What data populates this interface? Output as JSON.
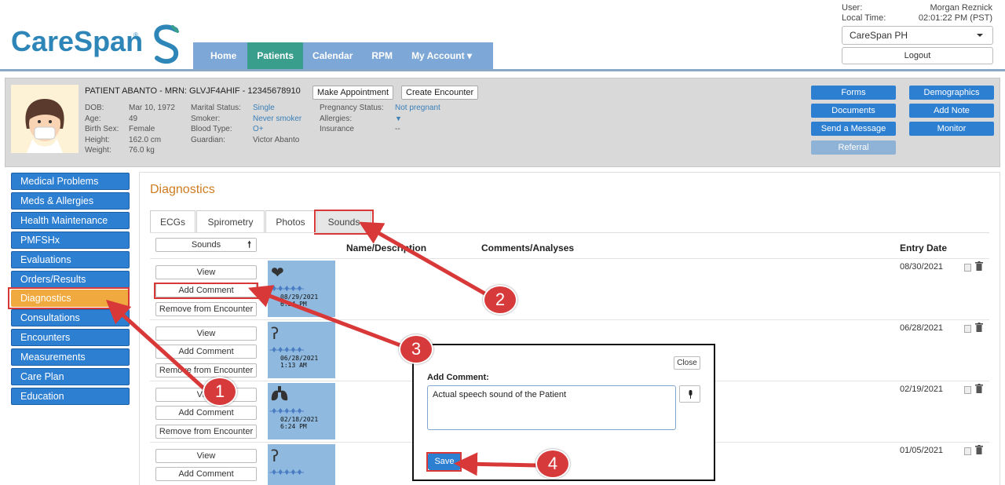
{
  "header": {
    "logo_text": "CareSpan",
    "logo_tm": "®",
    "nav": [
      "Home",
      "Patients",
      "Calendar",
      "RPM",
      "My Account ▾"
    ],
    "active_nav": "Patients",
    "user_label": "User:",
    "user_name": "Morgan Reznick",
    "time_label": "Local Time:",
    "local_time": "02:01:22 PM (PST)",
    "practice": "CareSpan PH",
    "logout": "Logout"
  },
  "patient": {
    "title": "PATIENT ABANTO - MRN: GLVJF4AHIF - 12345678910",
    "make_appointment": "Make Appointment",
    "create_encounter": "Create Encounter",
    "col1_labels": [
      "DOB:",
      "Age:",
      "Birth Sex:",
      "Height:",
      "Weight:"
    ],
    "col1_values": [
      "Mar 10, 1972",
      "49",
      "Female",
      "162.0 cm",
      "76.0 kg"
    ],
    "col2_labels": [
      "Marital Status:",
      "Smoker:",
      "Blood Type:",
      "Guardian:"
    ],
    "col2_values": [
      "Single",
      "Never smoker",
      "O+",
      "Victor Abanto"
    ],
    "col3_labels": [
      "Pregnancy Status:",
      "Allergies:",
      "Insurance"
    ],
    "col3_values": [
      "Not pregnant",
      "▼",
      "--"
    ],
    "actions_left": [
      "Forms",
      "Documents",
      "Send a Message",
      "Referral"
    ],
    "actions_right": [
      "Demographics",
      "Add Note",
      "Monitor"
    ]
  },
  "sidebar": {
    "items": [
      "Medical Problems",
      "Meds & Allergies",
      "Health Maintenance",
      "PMFSHx",
      "Evaluations",
      "Orders/Results",
      "Diagnostics",
      "Consultations",
      "Encounters",
      "Measurements",
      "Care Plan",
      "Education"
    ],
    "active": "Diagnostics"
  },
  "main": {
    "title": "Diagnostics",
    "tabs": [
      "ECGs",
      "Spirometry",
      "Photos",
      "Sounds"
    ],
    "active_tab": "Sounds",
    "sort_label": "Sounds",
    "columns": [
      "Name/Description",
      "Comments/Analyses",
      "Entry Date"
    ],
    "rows": [
      {
        "view": "View",
        "add_comment": "Add Comment",
        "remove": "Remove from Encounter",
        "icon": "heart-icon",
        "ts_date": "08/29/2021",
        "ts_time": "6:34 PM",
        "entry_date": "08/30/2021"
      },
      {
        "view": "View",
        "add_comment": "Add Comment",
        "remove": "Remove from Encounter",
        "icon": "ear-icon",
        "ts_date": "06/28/2021",
        "ts_time": "1:13 AM",
        "entry_date": "06/28/2021"
      },
      {
        "view": "View",
        "add_comment": "Add Comment",
        "remove": "Remove from Encounter",
        "icon": "lungs-icon",
        "ts_date": "02/18/2021",
        "ts_time": "6:24 PM",
        "entry_date": "02/19/2021"
      },
      {
        "view": "View",
        "add_comment": "Add Comment",
        "remove": "",
        "icon": "ear-icon",
        "ts_date": "",
        "ts_time": "",
        "entry_date": "01/05/2021"
      }
    ]
  },
  "modal": {
    "close": "Close",
    "label": "Add Comment:",
    "comment_value": "Actual speech sound of the Patient",
    "save": "Save"
  },
  "annotations": {
    "badges": [
      "1",
      "2",
      "3",
      "4"
    ],
    "accent": "#d93838"
  },
  "colors": {
    "nav_bg": "#7da7d6",
    "nav_active": "#3a9e8d",
    "button_blue": "#2d7fd2",
    "sidebar_active": "#f0a93e",
    "title_orange": "#cf7c22"
  }
}
